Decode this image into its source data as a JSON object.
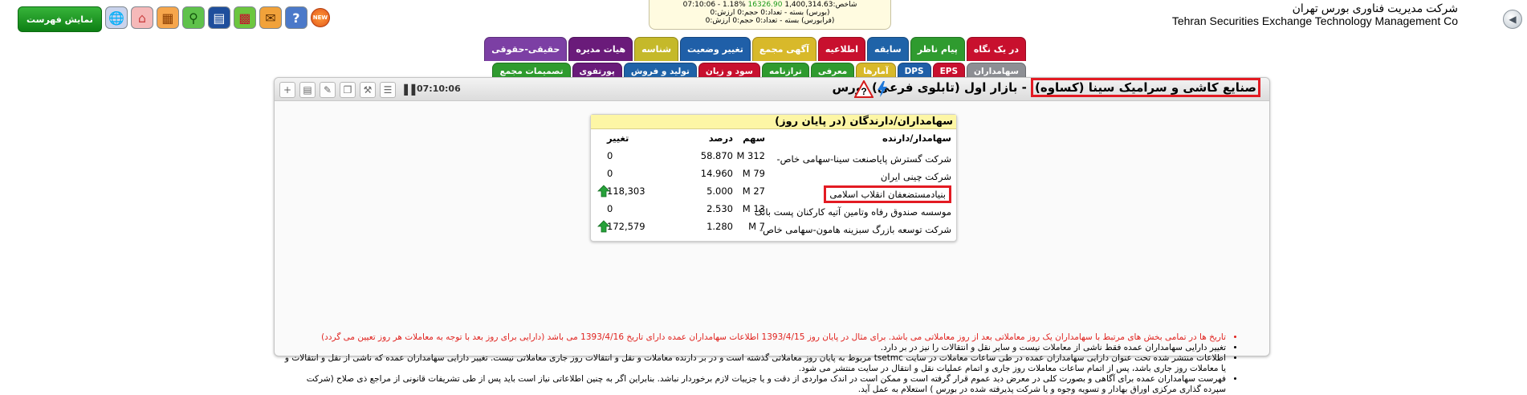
{
  "header": {
    "company_fa": "شرکت مدیریت فناوری بورس تهران",
    "company_en": "Tehran Securities Exchange Technology Management Co",
    "ticker": {
      "line1_prefix": "شاخص:",
      "line1_value": "1,400,314.63",
      "line1_change": "16326.90",
      "line1_pct": "%1.18",
      "line1_time": "07:10:06",
      "line2": "(بورس) بسته - تعداد:0 حجم:0 ارزش:0",
      "line3": "(فرابورس) بسته - تعداد:0 حجم:0 ارزش:0"
    },
    "show_list_label": "نمایش فهرست",
    "new_badge": "NEW",
    "toolbar_icons": [
      "globe-icon",
      "home-icon",
      "table-icon",
      "search-icon",
      "book-icon",
      "grid-icon",
      "comment-icon",
      "help-icon"
    ]
  },
  "tabs_row1": [
    {
      "label": "در یک نگاه",
      "color": "#c8102e"
    },
    {
      "label": "پیام ناظر",
      "color": "#2f9b2f"
    },
    {
      "label": "سابقه",
      "color": "#1f63a8"
    },
    {
      "label": "اطلاعیه",
      "color": "#c8102e"
    },
    {
      "label": "آگهی مجمع",
      "color": "#d8b92a"
    },
    {
      "label": "تغییر وضعیت",
      "color": "#1f5fa8"
    },
    {
      "label": "شناسه",
      "color": "#c5b92a"
    },
    {
      "label": "هیات مدیره",
      "color": "#6a1b7a"
    },
    {
      "label": "حقیقی-حقوقی",
      "color": "#7c3fa4"
    }
  ],
  "tabs_row2": [
    {
      "label": "سهامداران",
      "color": "#8d8f94"
    },
    {
      "label": "EPS",
      "color": "#c8102e"
    },
    {
      "label": "DPS",
      "color": "#1f5fa8"
    },
    {
      "label": "آمارها",
      "color": "#d8b92a"
    },
    {
      "label": "معرفی",
      "color": "#2f9b2f"
    },
    {
      "label": "ترازنامه",
      "color": "#2f9b2f"
    },
    {
      "label": "سود و زیان",
      "color": "#c8102e"
    },
    {
      "label": "تولید و فروش",
      "color": "#1f63a8"
    },
    {
      "label": "پورتفوی",
      "color": "#6a1b7a"
    },
    {
      "label": "تصمیمات مجمع",
      "color": "#2f9b2f"
    }
  ],
  "panel": {
    "symbol_name": "صنایع کاشی و سرامیک سینا (کساوه)",
    "market": " - بازار اول (تابلوی فرعی) بورس",
    "time": "07:10:06"
  },
  "holders": {
    "title": "سهامداران/دارندگان (در پایان روز)",
    "col_name": "سهامدار/دارنده",
    "col_shares": "سهم",
    "col_pct": "درصد",
    "col_change": "تغییر",
    "rows": [
      {
        "name": "شرکت گسترش پایاصنعت سینا-سهامی خاص-",
        "shares": "312 M",
        "pct": "58.870",
        "change": "0"
      },
      {
        "name": "شرکت چینی ایران",
        "shares": "79 M",
        "pct": "14.960",
        "change": "0"
      },
      {
        "name": "بنیادمستضعفان انقلاب اسلامی",
        "shares": "27 M",
        "pct": "5.000",
        "change": "118,303"
      },
      {
        "name": "موسسه صندوق رفاه وتامین آتیه کارکنان پست بانک",
        "shares": "13 M",
        "pct": "2.530",
        "change": "0"
      },
      {
        "name": "شرکت توسعه بازرگ سبزینه هامون-سهامی خاص-",
        "shares": "7 M",
        "pct": "1.280",
        "change": "172,579"
      }
    ]
  },
  "notes": [
    {
      "text": "تاریخ ها در تمامی بخش های مرتبط با سهامداران یک روز معاملاتی بعد از روز معاملاتی می باشد. برای مثال در پایان روز 1393/4/15 اطلاعات سهامداران عمده دارای تاریخ 1393/4/16 می باشد (دارایی برای روز بعد با توجه به معاملات هر روز تعیین می گردد)",
      "color": "#e0221e"
    },
    {
      "text": "تغییر دارایی سهامداران عمده فقط ناشی از معاملات نیست و سایر نقل و انتقالات را نیز در بر دارد.",
      "color": "#000000"
    },
    {
      "text": "اطلاعات منتشر شده تحت عنوان دارایی سهامداران عمده در طی ساعات معاملات در سایت tsetmc مربوط به پایان روز معاملاتی گذشته است و در بر دارنده معاملات و نقل و انتقالات روز جاری معاملاتی نیست. تغییر دارایی سهامداران عمده که ناشی از نقل و انتقالات و یا معاملات روز جاری باشد، پس از اتمام ساعات معاملات روز جاری و اتمام عملیات نقل و انتقال در سایت منتشر می شود.",
      "color": "#000000"
    },
    {
      "text": "فهرست سهامداران عمده برای آگاهی و بصورت کلی در معرض دید عموم قرار گرفته است و ممکن است در اندک مواردی از دقت و یا جزییات لازم برخوردار نباشد. بنابراین اگر به چنین اطلاعاتی نیاز است باید پس از طی تشریفات قانونی از مراجع ذی صلاح (شرکت سپرده گذاری مرکزی اوراق بهادار و تسویه وجوه و یا شرکت پذیرفته شده در بورس ) استعلام به عمل آید.",
      "color": "#000000"
    }
  ]
}
